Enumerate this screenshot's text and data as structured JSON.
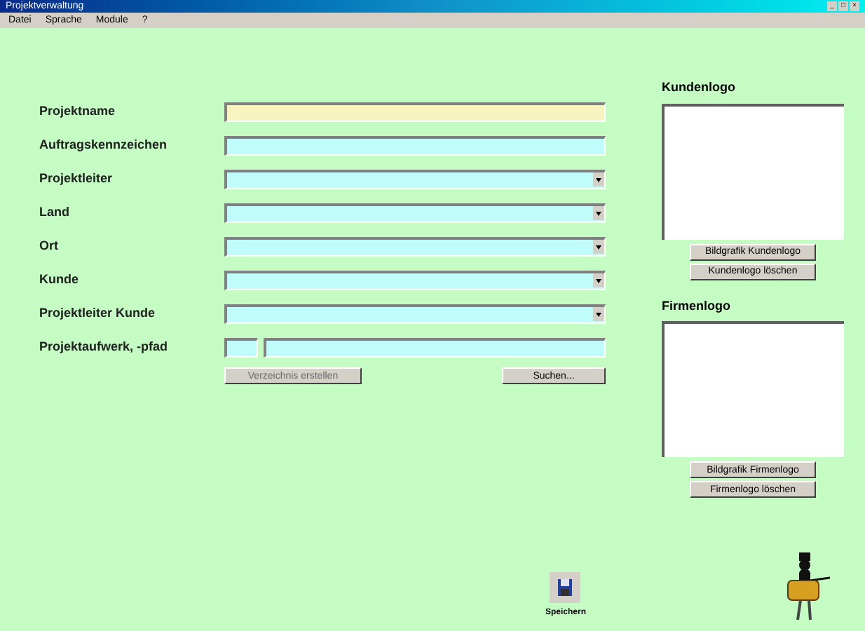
{
  "window": {
    "title": "Projektverwaltung",
    "controls": [
      "_",
      "□",
      "×"
    ]
  },
  "menu": [
    "Datei",
    "Sprache",
    "Module",
    "?"
  ],
  "fields": [
    {
      "label": "Projektname",
      "kind": "text",
      "focused": true
    },
    {
      "label": "Auftragskennzeichen",
      "kind": "text",
      "focused": false
    },
    {
      "label": "Projektleiter",
      "kind": "combo",
      "focused": false
    },
    {
      "label": "Land",
      "kind": "combo",
      "focused": false
    },
    {
      "label": "Ort",
      "kind": "combo",
      "focused": false
    },
    {
      "label": "Kunde",
      "kind": "combo",
      "focused": false
    },
    {
      "label": "Projektleiter Kunde",
      "kind": "combo",
      "focused": false
    },
    {
      "label": "Projektaufwerk, -pfad",
      "kind": "split",
      "focused": false
    }
  ],
  "form_buttons": [
    {
      "label": "Verzeichnis erstellen",
      "disabled": true
    },
    {
      "label": "Suchen...",
      "disabled": false
    }
  ],
  "logos": [
    {
      "title": "Kundenlogo",
      "buttons": [
        "Bildgrafik Kundenlogo",
        "Kundenlogo löschen"
      ]
    },
    {
      "title": "Firmenlogo",
      "buttons": [
        "Bildgrafik Firmenlogo",
        "Firmenlogo löschen"
      ]
    }
  ],
  "save": {
    "label": "Speichern"
  }
}
